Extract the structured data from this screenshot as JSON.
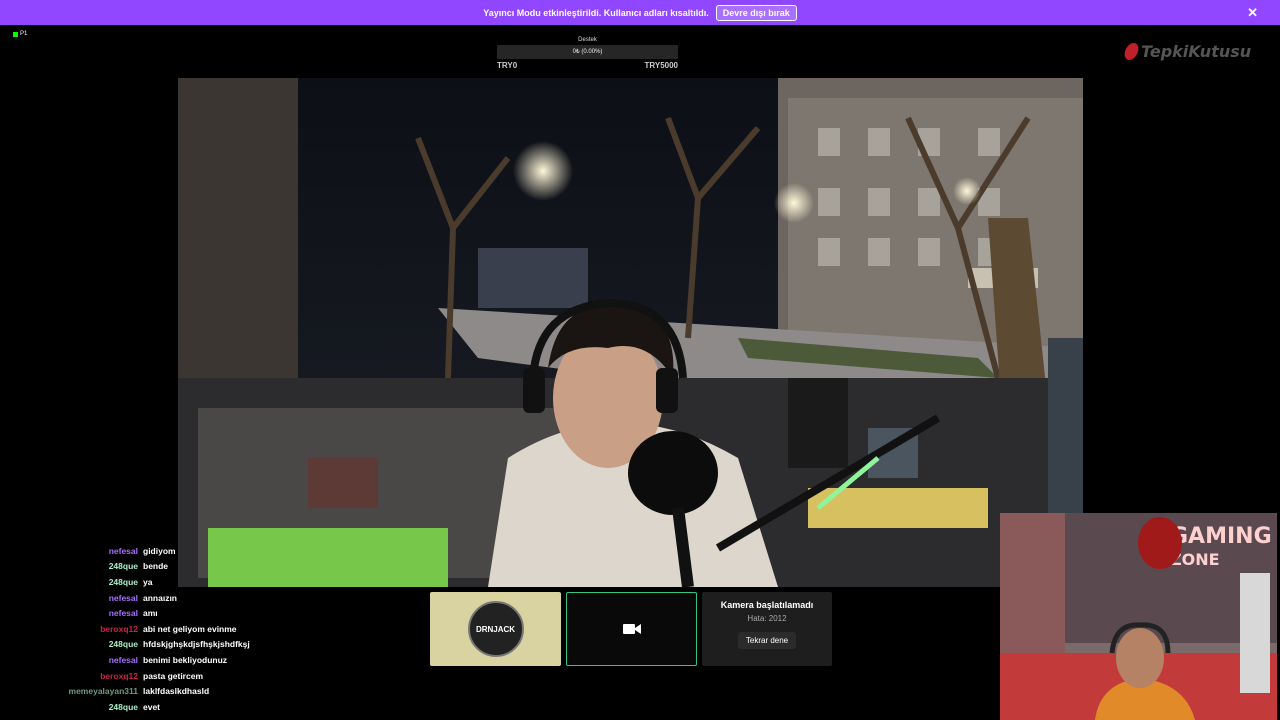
{
  "banner": {
    "text": "Yayıncı Modu etkinleştirildi. Kullanıcı adları kısaltıldı.",
    "button_label": "Devre dışı bırak",
    "close_icon": "close-icon"
  },
  "live_indicator": "P1",
  "goal": {
    "label": "Destek",
    "progress_text": "0₺ (0.00%)",
    "min": "TRY0",
    "max": "TRY5000",
    "progress_fraction": 0.0
  },
  "logo_text": "TepkiKutusu",
  "chat": [
    {
      "user": "nefesal",
      "color": "#a970ff",
      "msg": "gidiyom"
    },
    {
      "user": "248que",
      "color": "#a6f0c6",
      "msg": "bende"
    },
    {
      "user": "248que",
      "color": "#a6f0c6",
      "msg": "ya"
    },
    {
      "user": "nefesal",
      "color": "#a970ff",
      "msg": "annaızın"
    },
    {
      "user": "nefesal",
      "color": "#a970ff",
      "msg": "amı"
    },
    {
      "user": "beroxq12",
      "color": "#c8214b",
      "msg": "abi net geliyom evinme"
    },
    {
      "user": "248que",
      "color": "#a6f0c6",
      "msg": "hfdskjghşkdjsfhşkjshdfkşj"
    },
    {
      "user": "nefesal",
      "color": "#a970ff",
      "msg": "benimi bekliyodunuz"
    },
    {
      "user": "beroxq12",
      "color": "#c8214b",
      "msg": "pasta getircem"
    },
    {
      "user": "memeyalayan311",
      "color": "#6f9a7c",
      "msg": "laklfdaslkdhasld"
    },
    {
      "user": "248que",
      "color": "#a6f0c6",
      "msg": "evet"
    }
  ],
  "cards": {
    "badge_text": "DRNJACK",
    "camera_icon": "video-camera-icon",
    "error_title": "Kamera başlatılamadı",
    "error_code": "Hata: 2012",
    "retry_label": "Tekrar dene"
  }
}
